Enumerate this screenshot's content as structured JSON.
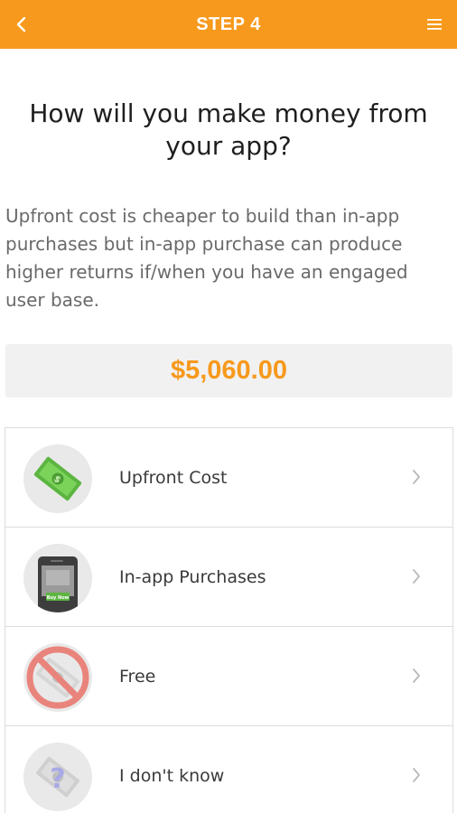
{
  "header": {
    "title": "STEP 4",
    "background": "#f7991c"
  },
  "question": "How will you make money from your app?",
  "description": "Upfront cost is cheaper to build than in-app purchases but in-app purchase can produce higher returns if/when you have an engaged user base.",
  "price": "$5,060.00",
  "accent_color": "#f7991c",
  "options": [
    {
      "label": "Upfront Cost",
      "icon": "money-bill-icon"
    },
    {
      "label": "In-app Purchases",
      "icon": "phone-buy-now-icon",
      "icon_text": "Buy Now"
    },
    {
      "label": "Free",
      "icon": "no-money-icon"
    },
    {
      "label": "I don't know",
      "icon": "money-question-icon",
      "icon_text": "?"
    }
  ]
}
